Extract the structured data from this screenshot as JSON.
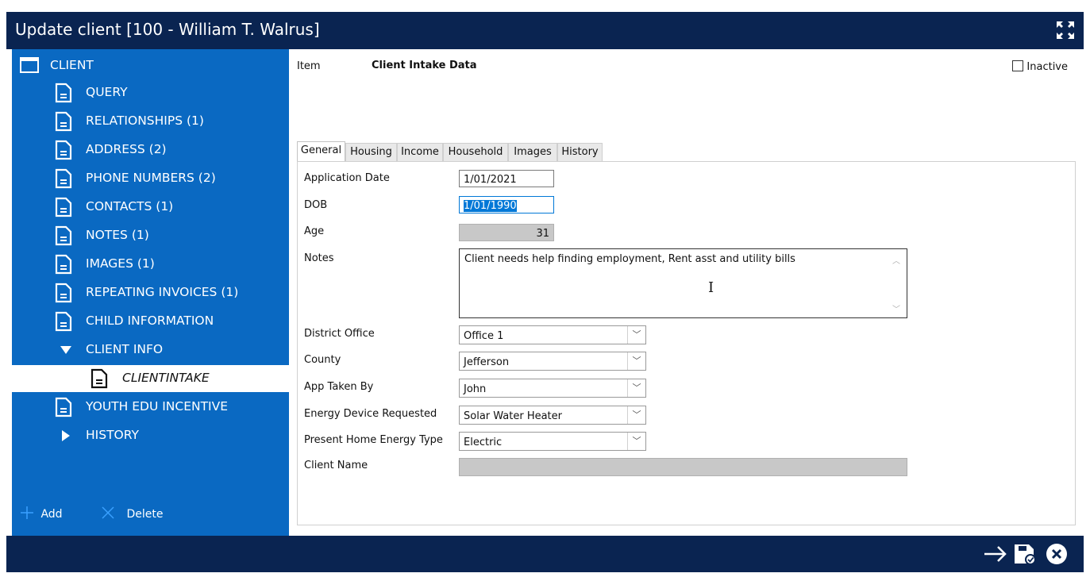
{
  "window": {
    "title": "Update client [100 - William T. Walrus]"
  },
  "sidebar": {
    "root_label": "CLIENT",
    "items": [
      {
        "label": "QUERY",
        "icon": "document-icon"
      },
      {
        "label": "RELATIONSHIPS (1)",
        "icon": "document-icon"
      },
      {
        "label": "ADDRESS (2)",
        "icon": "document-icon"
      },
      {
        "label": "PHONE NUMBERS (2)",
        "icon": "document-icon"
      },
      {
        "label": "CONTACTS (1)",
        "icon": "document-icon"
      },
      {
        "label": "NOTES (1)",
        "icon": "document-icon"
      },
      {
        "label": "IMAGES (1)",
        "icon": "document-icon"
      },
      {
        "label": "REPEATING INVOICES (1)",
        "icon": "document-icon"
      },
      {
        "label": "CHILD INFORMATION",
        "icon": "document-icon"
      },
      {
        "label": "CLIENT INFO",
        "icon": "expanded-triangle-icon"
      },
      {
        "label": "CLIENTINTAKE",
        "icon": "document-icon",
        "selected": true
      },
      {
        "label": "YOUTH EDU INCENTIVE",
        "icon": "document-icon"
      },
      {
        "label": "HISTORY",
        "icon": "collapsed-triangle-icon"
      }
    ],
    "add_label": "Add",
    "delete_label": "Delete"
  },
  "header": {
    "item_label": "Item",
    "item_value": "Client Intake Data",
    "inactive_label": "Inactive",
    "inactive_checked": false
  },
  "tabs": [
    "General",
    "Housing",
    "Income",
    "Household",
    "Images",
    "History"
  ],
  "active_tab": "General",
  "form": {
    "application_date": {
      "label": "Application Date",
      "value": "1/01/2021"
    },
    "dob": {
      "label": "DOB",
      "value": "1/01/1990"
    },
    "age": {
      "label": "Age",
      "value": "31"
    },
    "notes": {
      "label": "Notes",
      "value": "Client needs help finding employment, Rent asst and utility bills"
    },
    "district_office": {
      "label": "District Office",
      "value": "Office 1"
    },
    "county": {
      "label": "County",
      "value": "Jefferson"
    },
    "app_taken_by": {
      "label": "App Taken By",
      "value": "John"
    },
    "energy_device": {
      "label": "Energy Device Requested",
      "value": "Solar Water Heater"
    },
    "home_energy_type": {
      "label": "Present Home Energy Type",
      "value": "Electric"
    },
    "client_name": {
      "label": "Client Name",
      "value": ""
    }
  },
  "colors": {
    "titlebar": "#0a2451",
    "sidebar": "#0a69c2",
    "accent": "#0078d7"
  }
}
